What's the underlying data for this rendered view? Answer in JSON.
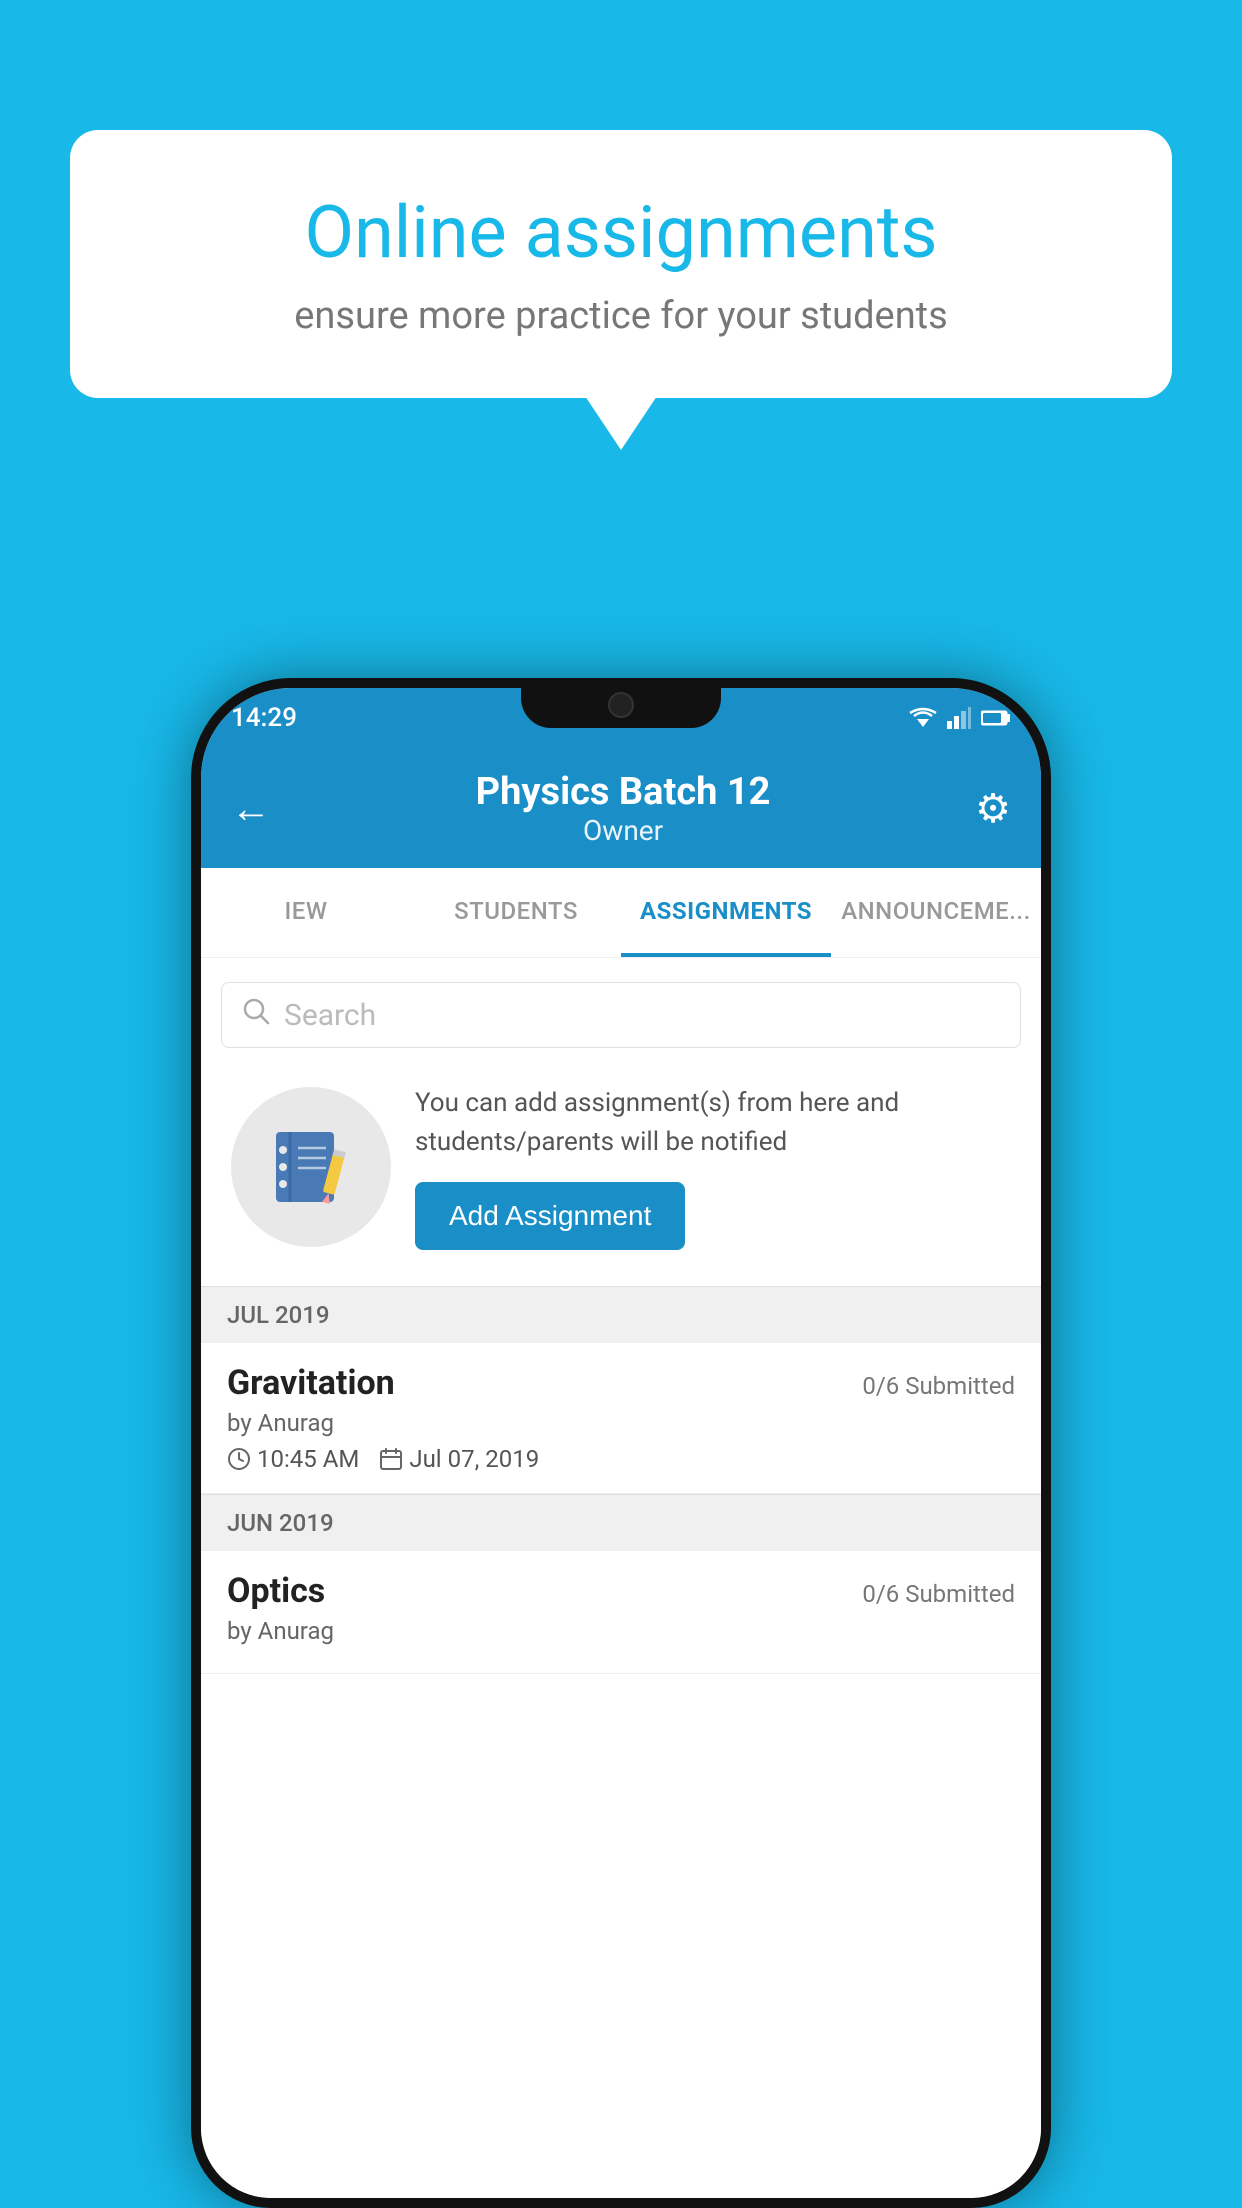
{
  "background_color": "#18b8e8",
  "speech_bubble": {
    "title": "Online assignments",
    "subtitle": "ensure more practice for your students"
  },
  "status_bar": {
    "time": "14:29"
  },
  "header": {
    "title": "Physics Batch 12",
    "subtitle": "Owner",
    "back_label": "←",
    "gear_label": "⚙"
  },
  "tabs": [
    {
      "label": "IEW",
      "active": false
    },
    {
      "label": "STUDENTS",
      "active": false
    },
    {
      "label": "ASSIGNMENTS",
      "active": true
    },
    {
      "label": "ANNOUNCEMENTS",
      "active": false
    }
  ],
  "search": {
    "placeholder": "Search"
  },
  "info_card": {
    "description": "You can add assignment(s) from here and students/parents will be notified",
    "button_label": "Add Assignment"
  },
  "sections": [
    {
      "header": "JUL 2019",
      "assignments": [
        {
          "name": "Gravitation",
          "submitted": "0/6 Submitted",
          "by": "by Anurag",
          "time": "10:45 AM",
          "date": "Jul 07, 2019"
        }
      ]
    },
    {
      "header": "JUN 2019",
      "assignments": [
        {
          "name": "Optics",
          "submitted": "0/6 Submitted",
          "by": "by Anurag",
          "time": "",
          "date": ""
        }
      ]
    }
  ]
}
